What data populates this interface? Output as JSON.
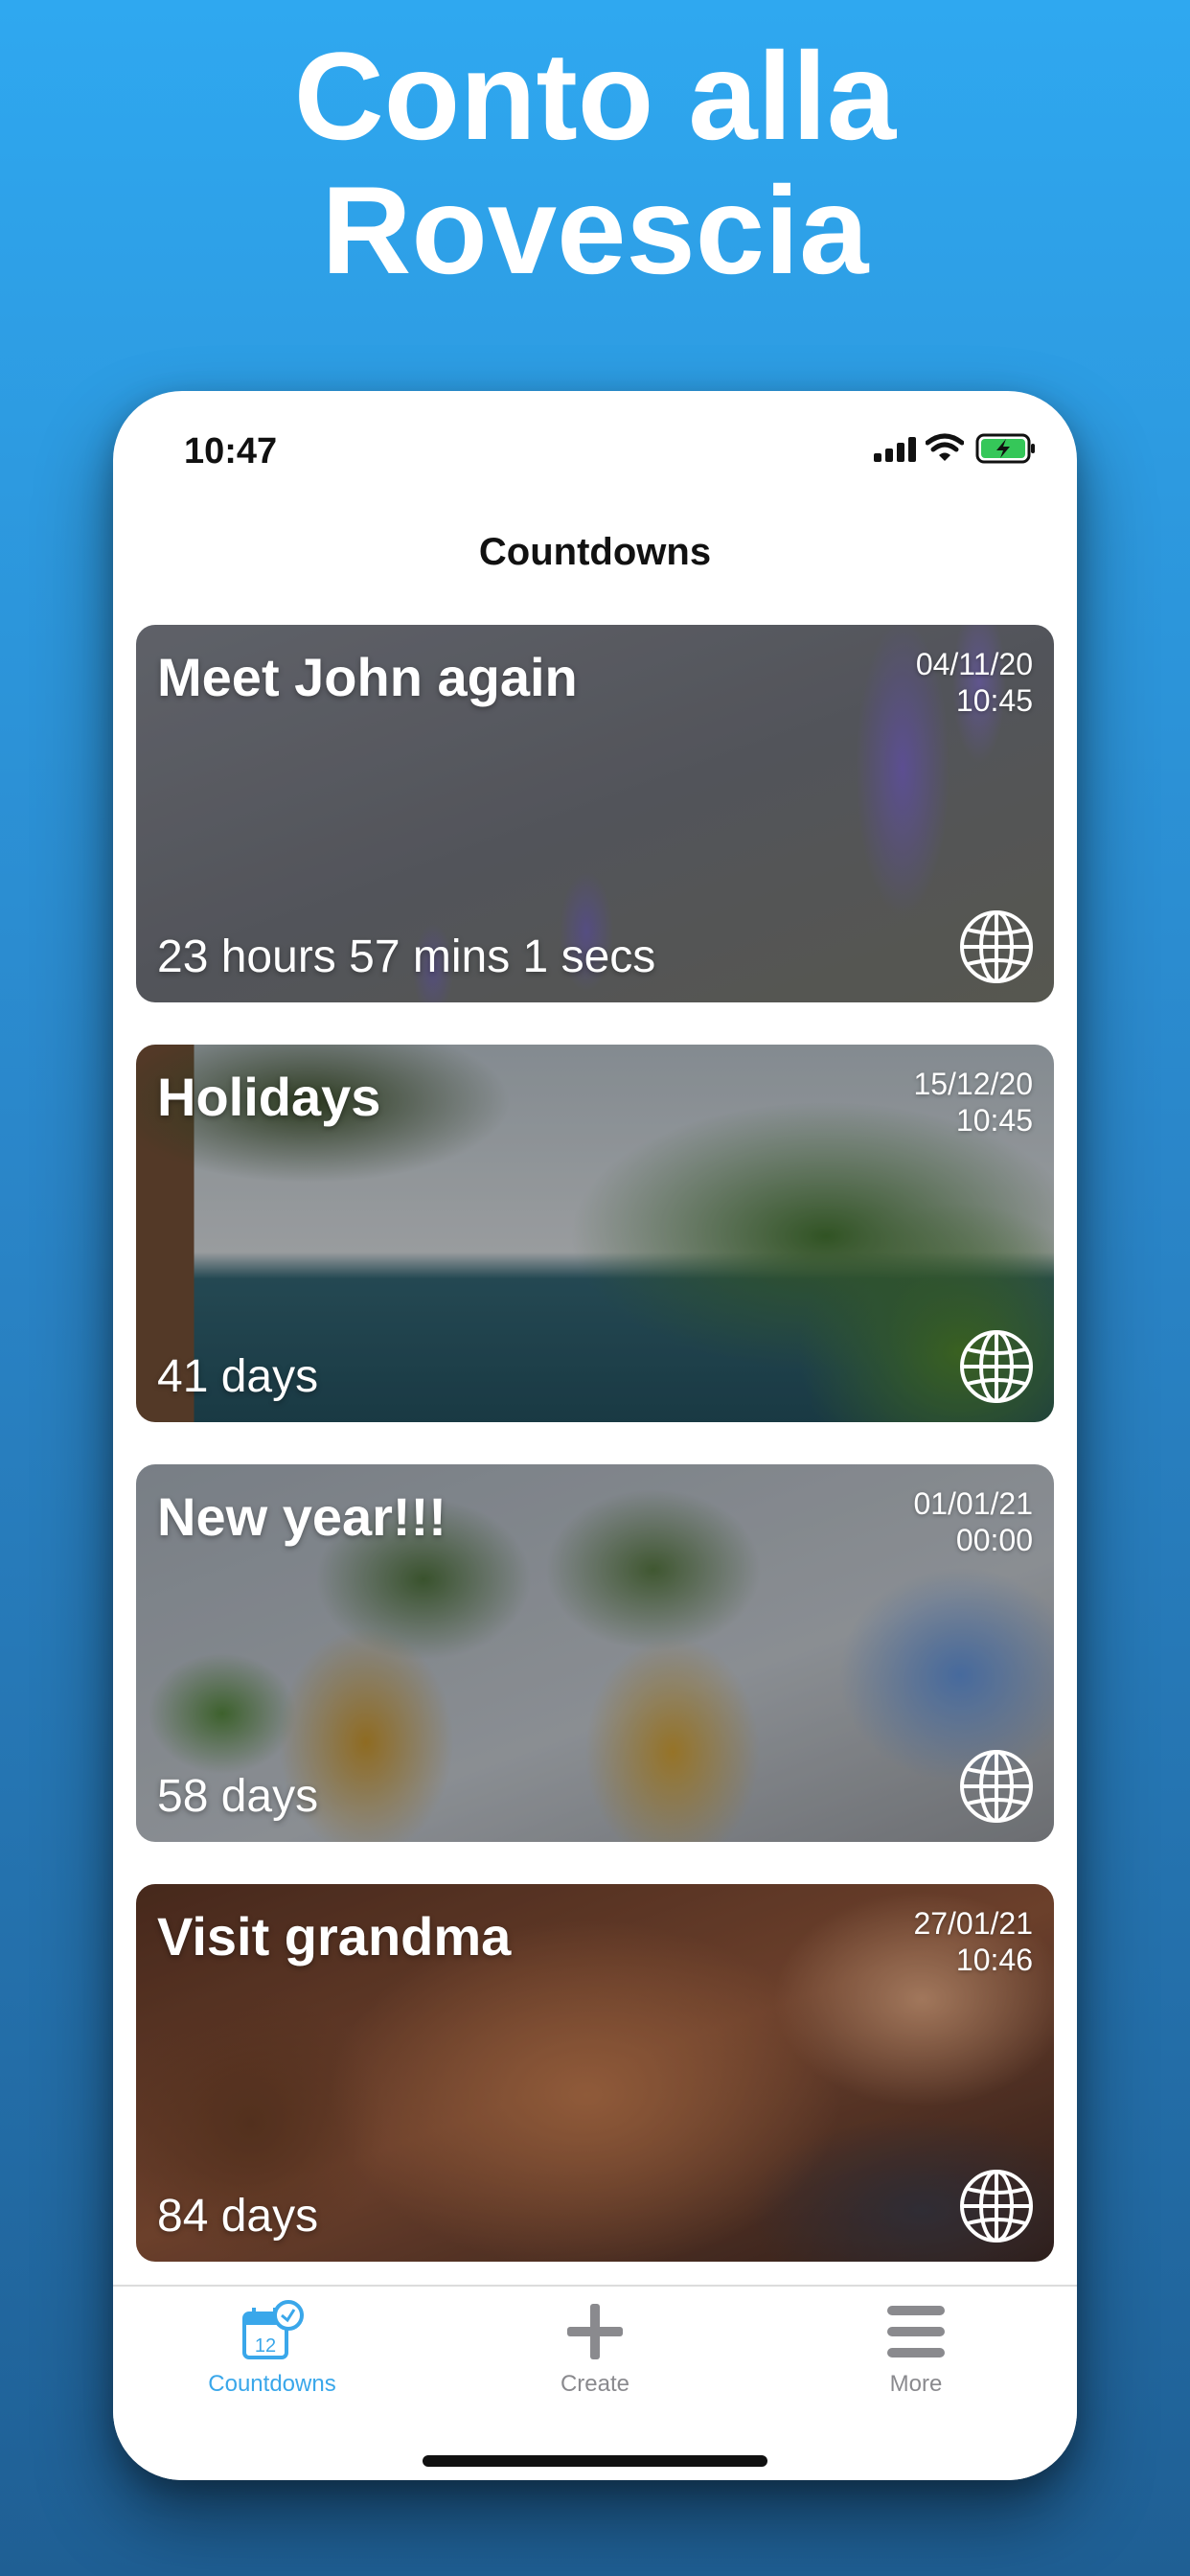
{
  "headline": {
    "line1": "Conto alla",
    "line2": "Rovescia"
  },
  "status_bar": {
    "time": "10:47"
  },
  "nav": {
    "title": "Countdowns"
  },
  "cards": [
    {
      "title": "Meet John again",
      "date": "04/11/20",
      "time": "10:45",
      "remaining": "23 hours 57 mins 1 secs"
    },
    {
      "title": "Holidays",
      "date": "15/12/20",
      "time": "10:45",
      "remaining": "41 days"
    },
    {
      "title": "New year!!!",
      "date": "01/01/21",
      "time": "00:00",
      "remaining": "58 days"
    },
    {
      "title": "Visit grandma",
      "date": "27/01/21",
      "time": "10:46",
      "remaining": "84 days"
    }
  ],
  "tab_bar": {
    "tabs": [
      {
        "label": "Countdowns",
        "icon": "calendar-clock-icon",
        "active": true
      },
      {
        "label": "Create",
        "icon": "plus-icon",
        "active": false
      },
      {
        "label": "More",
        "icon": "menu-icon",
        "active": false
      }
    ],
    "calendar_number": "12"
  },
  "colors": {
    "background_top": "#2fa8f0",
    "background_bottom": "#1f5f94",
    "accent": "#3aa7ea",
    "inactive_tab": "#8a8a8e",
    "battery_charging": "#35c759"
  }
}
